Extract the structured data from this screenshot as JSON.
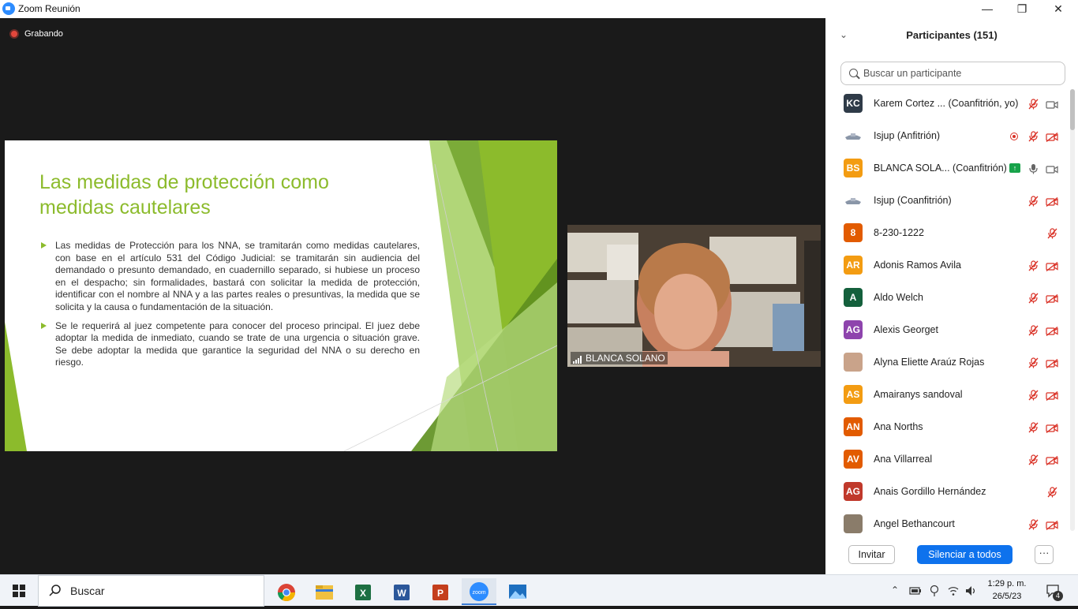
{
  "window": {
    "title": "Zoom Reunión",
    "minimize_glyph": "—",
    "restore_glyph": "❐",
    "close_glyph": "✕"
  },
  "recording": {
    "label": "Grabando"
  },
  "slide": {
    "title": "Las medidas de protección como medidas cautelares",
    "bullets": [
      "Las medidas de Protección para los NNA, se tramitarán como medidas cautelares, con base en el artículo 531 del Código Judicial:  se tramitarán sin audiencia del demandado o presunto demandado, en cuadernillo separado, si hubiese un proceso en el despacho; sin formalidades, bastará con solicitar la medida de protección, identificar con el nombre al NNA y a las partes reales o presuntivas, la medida que se solicita y la causa o fundamentación de la situación.",
      "Se le requerirá al juez competente para conocer del proceso principal.  El juez debe adoptar la medida de inmediato, cuando se trate de una urgencia o situación grave. Se debe adoptar la medida que garantice la seguridad del NNA o su derecho en riesgo."
    ],
    "accent_color": "#8cbb2c"
  },
  "video": {
    "participant_name": "BLANCA SOLANO"
  },
  "participants_panel": {
    "title": "Participantes (151)",
    "search_placeholder": "Buscar un participante",
    "participants": [
      {
        "initials": "KC",
        "name": "Karem Cortez ... (Coanfitrión, yo)",
        "color": "#2f3b48",
        "mic": "muted",
        "video": "on"
      },
      {
        "initials": "",
        "name": "Isjup (Anfitrión)",
        "color": "#ffffff",
        "mic": "muted",
        "video": "off",
        "recording": true
      },
      {
        "initials": "BS",
        "name": "BLANCA SOLA... (Coanfitrión)",
        "color": "#f39c12",
        "mic": "on",
        "video": "on",
        "badge": "↑"
      },
      {
        "initials": "",
        "name": "Isjup (Coanfitrión)",
        "color": "#ffffff",
        "mic": "muted",
        "video": "off"
      },
      {
        "initials": "8",
        "name": "8-230-1222",
        "color": "#e25b00",
        "mic": "muted",
        "video": "none"
      },
      {
        "initials": "AR",
        "name": "Adonis Ramos Avila",
        "color": "#f39c12",
        "mic": "muted",
        "video": "off"
      },
      {
        "initials": "A",
        "name": "Aldo Welch",
        "color": "#14603c",
        "mic": "muted",
        "video": "off"
      },
      {
        "initials": "AG",
        "name": "Alexis Georget",
        "color": "#8e44ad",
        "mic": "muted",
        "video": "off"
      },
      {
        "initials": "",
        "name": "Alyna Eliette Araúz Rojas",
        "color": "#c9a38a",
        "mic": "muted",
        "video": "off"
      },
      {
        "initials": "AS",
        "name": "Amairanys sandoval",
        "color": "#f39c12",
        "mic": "muted",
        "video": "off"
      },
      {
        "initials": "AN",
        "name": "Ana Norths",
        "color": "#e25b00",
        "mic": "muted",
        "video": "off"
      },
      {
        "initials": "AV",
        "name": "Ana Villarreal",
        "color": "#e25b00",
        "mic": "muted",
        "video": "off"
      },
      {
        "initials": "AG",
        "name": "Anais Gordillo Hernández",
        "color": "#c0392b",
        "mic": "muted",
        "video": "none"
      },
      {
        "initials": "",
        "name": "Angel Bethancourt",
        "color": "#8a7c6a",
        "mic": "muted",
        "video": "off"
      }
    ],
    "invite_label": "Invitar",
    "mute_all_label": "Silenciar a todos",
    "more_label": "···"
  },
  "taskbar": {
    "search_label": "Buscar",
    "time": "1:29 p. m.",
    "date": "26/5/23",
    "notification_count": "4",
    "apps": [
      "chrome-icon",
      "file-explorer-icon",
      "excel-icon",
      "word-icon",
      "powerpoint-icon",
      "zoom-icon",
      "photos-icon"
    ],
    "app_letters": {
      "excel": "X",
      "word": "W",
      "powerpoint": "P",
      "zoom": "zoom"
    }
  }
}
